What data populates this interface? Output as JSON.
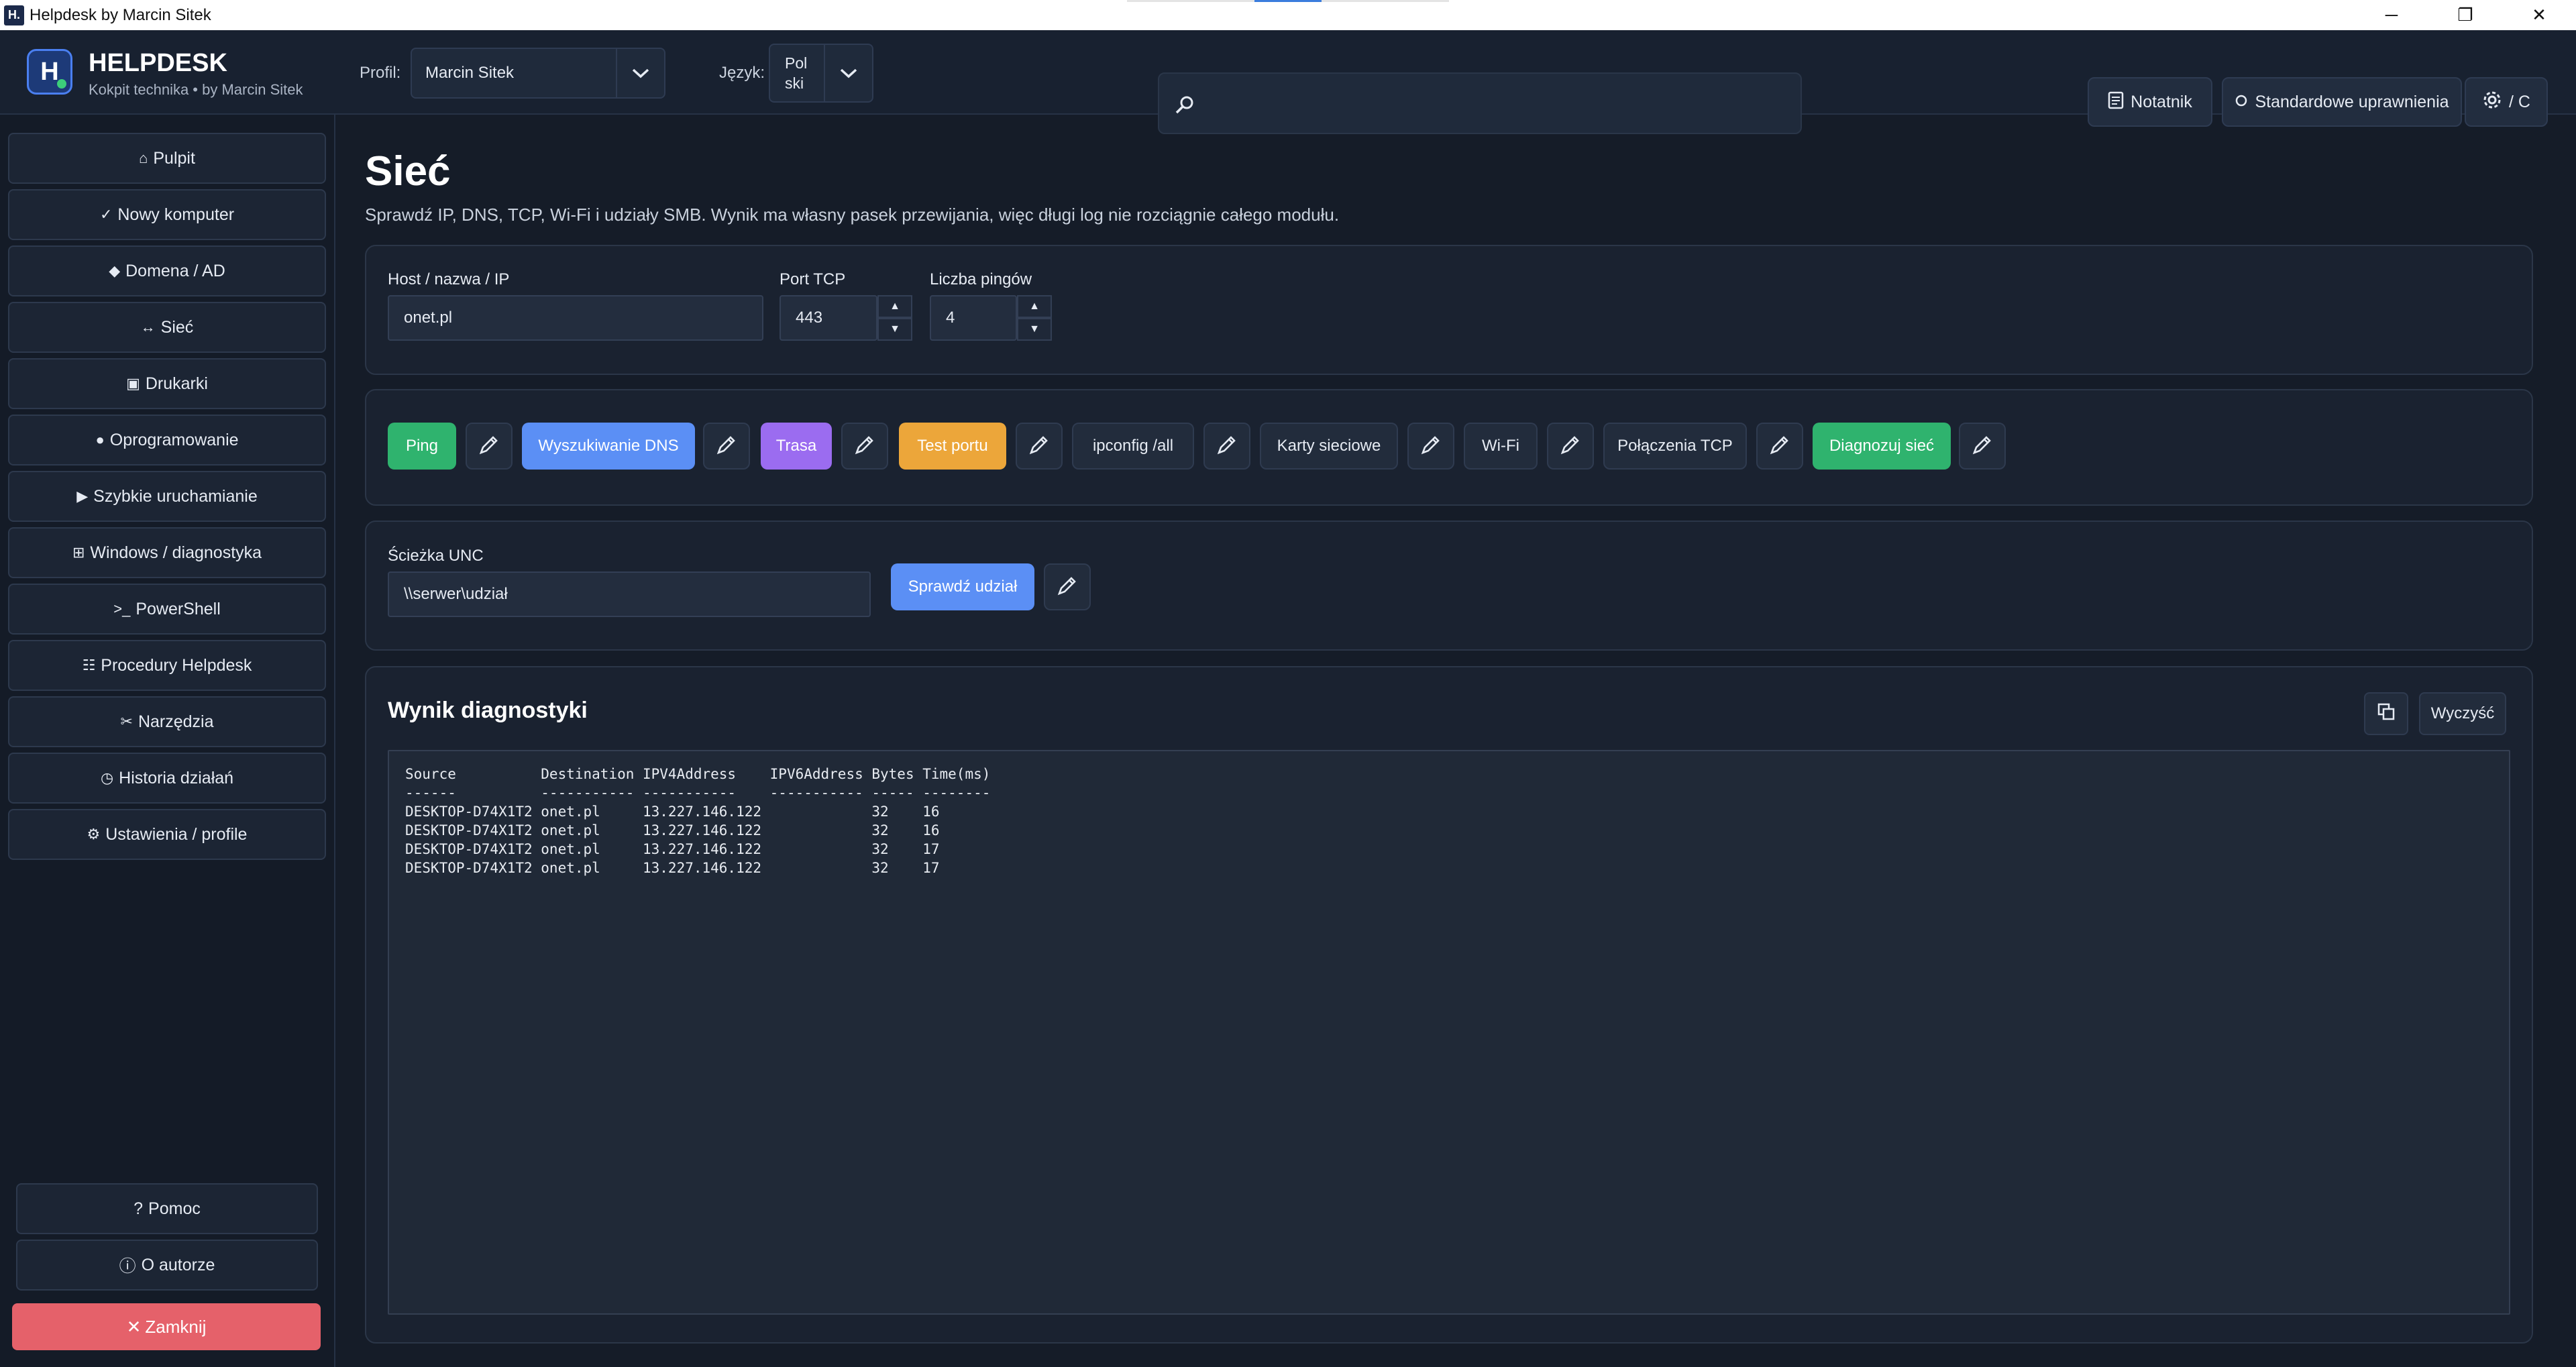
{
  "window": {
    "title": "Helpdesk by Marcin Sitek",
    "app_icon": "H.",
    "minimize": "─",
    "maximize": "❐",
    "close": "✕"
  },
  "header": {
    "logo_letter": "H",
    "brand": "HELPDESK",
    "subtitle": "Kokpit technika • by Marcin Sitek",
    "profile_label": "Profil:",
    "profile_value": "Marcin Sitek",
    "language_label": "Język:",
    "language_value_line1": "Pol",
    "language_value_line2": "ski",
    "search_placeholder": "",
    "notes_label": "Notatnik",
    "permissions_label": "Standardowe uprawnienia",
    "theme_label": "/ C"
  },
  "sidebar": {
    "items": [
      {
        "icon": "⌂",
        "label": "Pulpit"
      },
      {
        "icon": "✓",
        "label": "Nowy komputer"
      },
      {
        "icon": "◆",
        "label": "Domena / AD"
      },
      {
        "icon": "↔",
        "label": "Sieć"
      },
      {
        "icon": "▣",
        "label": "Drukarki"
      },
      {
        "icon": "●",
        "label": "Oprogramowanie"
      },
      {
        "icon": "▶",
        "label": "Szybkie uruchamianie"
      },
      {
        "icon": "⊞",
        "label": "Windows / diagnostyka"
      },
      {
        "icon": ">_",
        "label": "PowerShell"
      },
      {
        "icon": "☷",
        "label": "Procedury Helpdesk"
      },
      {
        "icon": "✂",
        "label": "Narzędzia"
      },
      {
        "icon": "◷",
        "label": "Historia działań"
      },
      {
        "icon": "⚙",
        "label": "Ustawienia / profile"
      }
    ],
    "help": {
      "icon": "?",
      "label": "Pomoc"
    },
    "about": {
      "icon": "ⓘ",
      "label": "O autorze"
    },
    "close": {
      "icon": "✕",
      "label": "Zamknij"
    }
  },
  "main": {
    "title": "Sieć",
    "description": "Sprawdź IP, DNS, TCP, Wi-Fi i udziały SMB. Wynik ma własny pasek przewijania, więc długi log nie rozciągnie całego modułu.",
    "host_label": "Host / nazwa / IP",
    "host_value": "onet.pl",
    "port_label": "Port TCP",
    "port_value": "443",
    "ping_count_label": "Liczba pingów",
    "ping_count_value": "4",
    "spin_up": "▲",
    "spin_down": "▼",
    "actions": [
      {
        "label": "Ping",
        "color": "#2fb36e"
      },
      {
        "label": "Wyszukiwanie DNS",
        "color": "#5b8ff5"
      },
      {
        "label": "Trasa",
        "color": "#9b6cf0"
      },
      {
        "label": "Test portu",
        "color": "#eca63a"
      },
      {
        "label": "ipconfig /all",
        "color": ""
      },
      {
        "label": "Karty sieciowe",
        "color": ""
      },
      {
        "label": "Wi-Fi",
        "color": ""
      },
      {
        "label": "Połączenia TCP",
        "color": ""
      },
      {
        "label": "Diagnozuj sieć",
        "color": "#2fb36e"
      }
    ],
    "unc_label": "Ścieżka UNC",
    "unc_value": "\\\\serwer\\udział",
    "check_share_label": "Sprawdź udział",
    "result_title": "Wynik diagnostyki",
    "clear_label": "Wyczyść",
    "output_lines": [
      "Source          Destination IPV4Address    IPV6Address Bytes Time(ms)",
      "------          ----------- -----------    ----------- ----- --------",
      "DESKTOP-D74X1T2 onet.pl     13.227.146.122             32    16",
      "DESKTOP-D74X1T2 onet.pl     13.227.146.122             32    16",
      "DESKTOP-D74X1T2 onet.pl     13.227.146.122             32    17",
      "DESKTOP-D74X1T2 onet.pl     13.227.146.122             32    17"
    ]
  }
}
